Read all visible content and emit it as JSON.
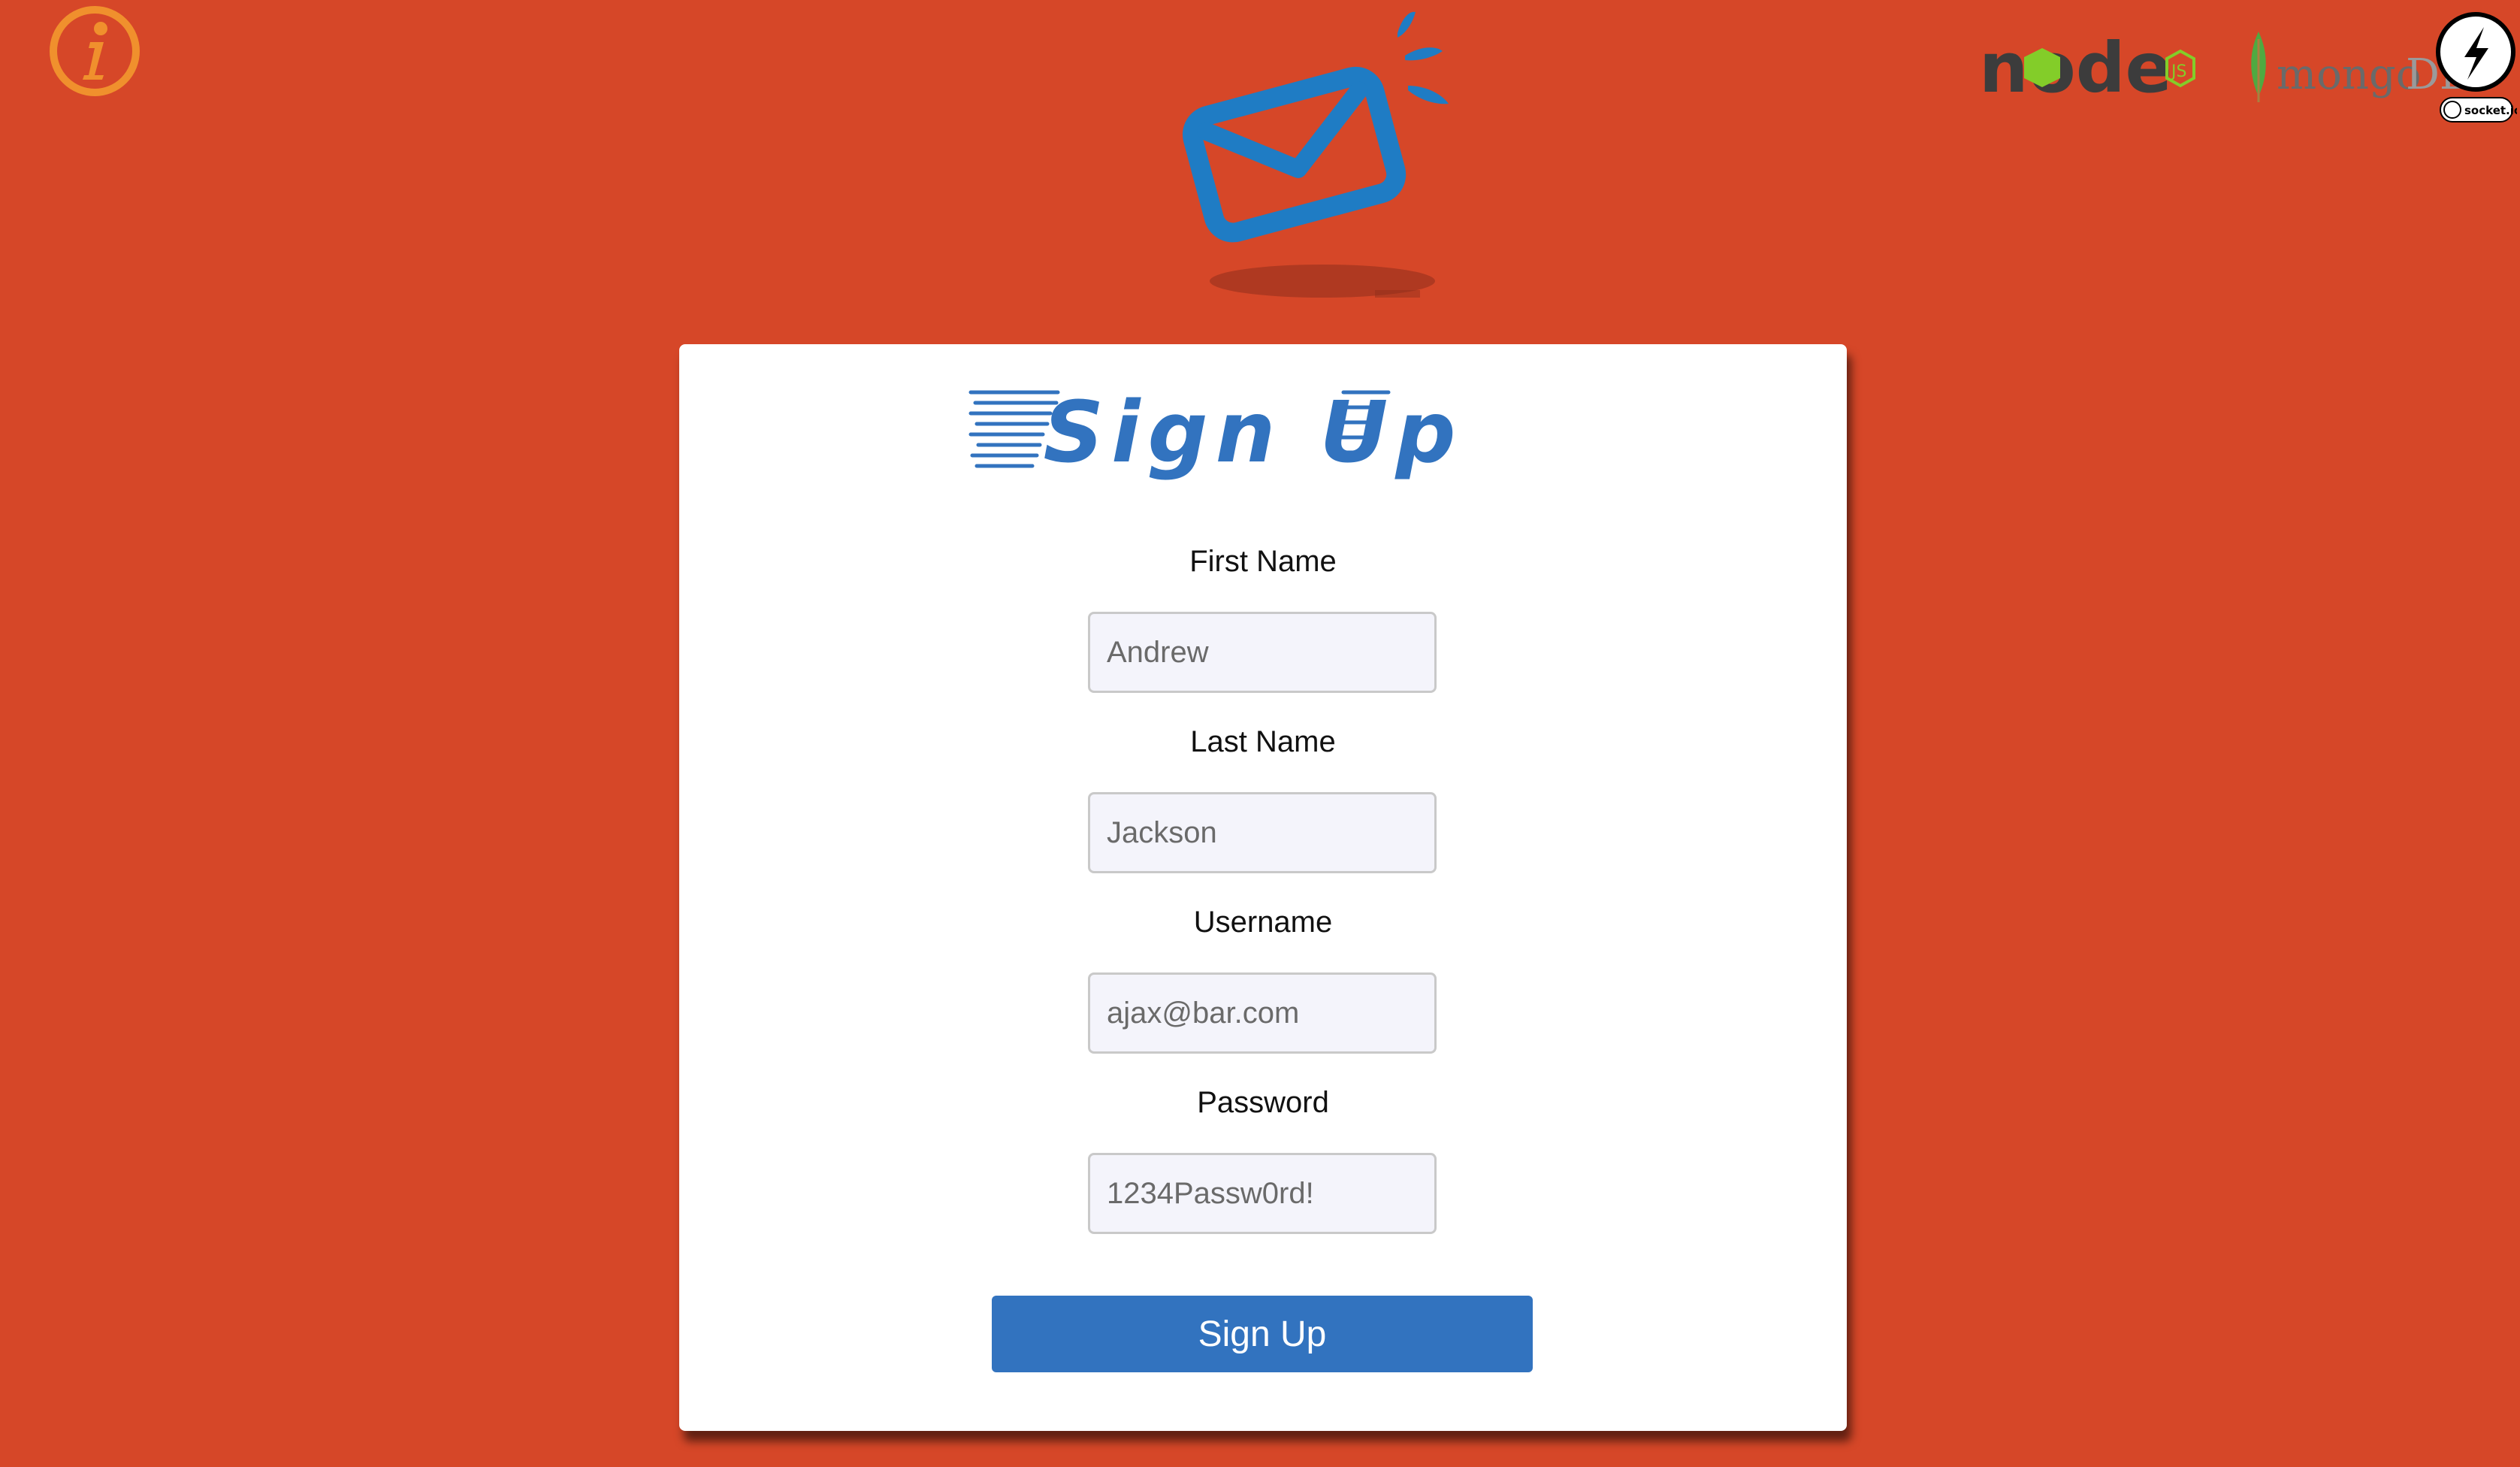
{
  "colors": {
    "background": "#D64728",
    "accent": "#3273BF",
    "info_icon": "#F0902D",
    "card": "#FFFFFF"
  },
  "header": {
    "info_icon": "info-icon",
    "mail_icon": "envelope-icon",
    "tech_logos": {
      "node": "node",
      "node_js": "JS",
      "mongo_text": "mongo",
      "mongo_db": "DB",
      "socket": "socket.io"
    }
  },
  "form": {
    "title": "Sign Up",
    "fields": [
      {
        "label": "First Name",
        "placeholder": "Andrew"
      },
      {
        "label": "Last Name",
        "placeholder": "Jackson"
      },
      {
        "label": "Username",
        "placeholder": "ajax@bar.com"
      },
      {
        "label": "Password",
        "placeholder": "1234Passw0rd!"
      }
    ],
    "submit_label": "Sign Up"
  }
}
